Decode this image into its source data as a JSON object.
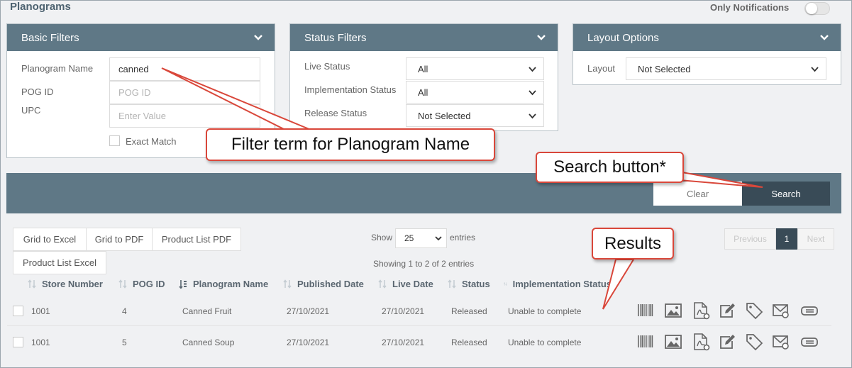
{
  "header": {
    "title": "Planograms",
    "notifications_label": "Only Notifications"
  },
  "basic_filters": {
    "title": "Basic Filters",
    "planogram_name_label": "Planogram Name",
    "planogram_name_value": "canned",
    "pog_id_label": "POG ID",
    "pog_id_placeholder": "POG ID",
    "upc_label": "UPC",
    "upc_placeholder": "Enter Value",
    "exact_match_label": "Exact Match"
  },
  "status_filters": {
    "title": "Status Filters",
    "live_status_label": "Live Status",
    "live_status_value": "All",
    "implementation_status_label": "Implementation Status",
    "implementation_status_value": "All",
    "release_status_label": "Release Status",
    "release_status_value": "Not Selected"
  },
  "layout_options": {
    "title": "Layout Options",
    "layout_label": "Layout",
    "layout_value": "Not Selected"
  },
  "search_bar": {
    "clear_label": "Clear",
    "search_label": "Search"
  },
  "export": {
    "grid_excel": "Grid to Excel",
    "grid_pdf": "Grid to PDF",
    "product_list_pdf": "Product List PDF",
    "product_list_excel": "Product List Excel"
  },
  "length": {
    "show_label": "Show",
    "value": "25",
    "entries_label": "entries"
  },
  "info_text": "Showing 1 to 2 of 2 entries",
  "pagination": {
    "previous": "Previous",
    "current": "1",
    "next": "Next"
  },
  "table": {
    "columns": [
      "Store Number",
      "POG ID",
      "Planogram Name",
      "Published Date",
      "Live Date",
      "Status",
      "Implementation Status"
    ],
    "rows": [
      {
        "store": "1001",
        "pog_id": "4",
        "name": "Canned Fruit",
        "published": "27/10/2021",
        "live": "27/10/2021",
        "status": "Released",
        "implementation": "Unable to complete"
      },
      {
        "store": "1001",
        "pog_id": "5",
        "name": "Canned Soup",
        "published": "27/10/2021",
        "live": "27/10/2021",
        "status": "Released",
        "implementation": "Unable to complete"
      }
    ],
    "row_actions": [
      "barcode-icon",
      "image-icon",
      "pdf-settings-icon",
      "edit-icon",
      "tag-icon",
      "email-icon",
      "ticket-icon"
    ]
  },
  "annotations": {
    "filter_term": "Filter term for Planogram Name",
    "search_button": "Search button*",
    "results": "Results"
  },
  "colors": {
    "panel_header": "#5f7886",
    "search_button": "#394b57",
    "callout_border": "#d9473a",
    "background": "#f0f1f3"
  }
}
